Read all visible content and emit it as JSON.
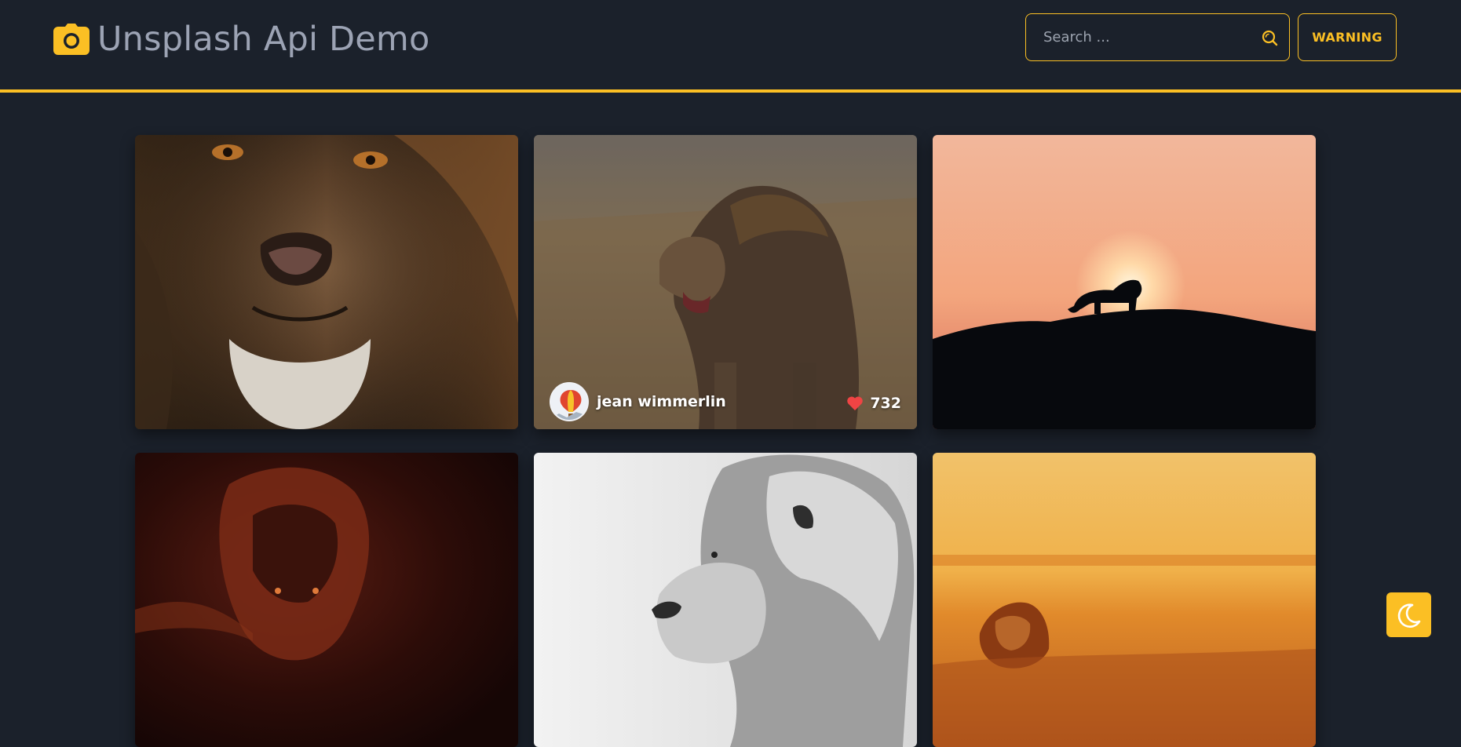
{
  "header": {
    "title": "Unsplash Api Demo",
    "brand_icon": "camera-icon",
    "search_placeholder": "Search ...",
    "warning_label": "WARNING"
  },
  "colors": {
    "accent": "#fbbf24",
    "background": "#1b212b",
    "title_text": "#9ca3b4",
    "like_heart": "#ef4444"
  },
  "gallery": {
    "photos": [
      {
        "subject": "lion face close-up"
      },
      {
        "subject": "lion in tall grass",
        "author": "jean wimmerlin",
        "likes": "732"
      },
      {
        "subject": "lion silhouette at sunset"
      },
      {
        "subject": "lion in red light"
      },
      {
        "subject": "black and white lion profile"
      },
      {
        "subject": "lion lying in golden field"
      }
    ]
  },
  "theme_toggle": {
    "icon": "moon-icon"
  }
}
